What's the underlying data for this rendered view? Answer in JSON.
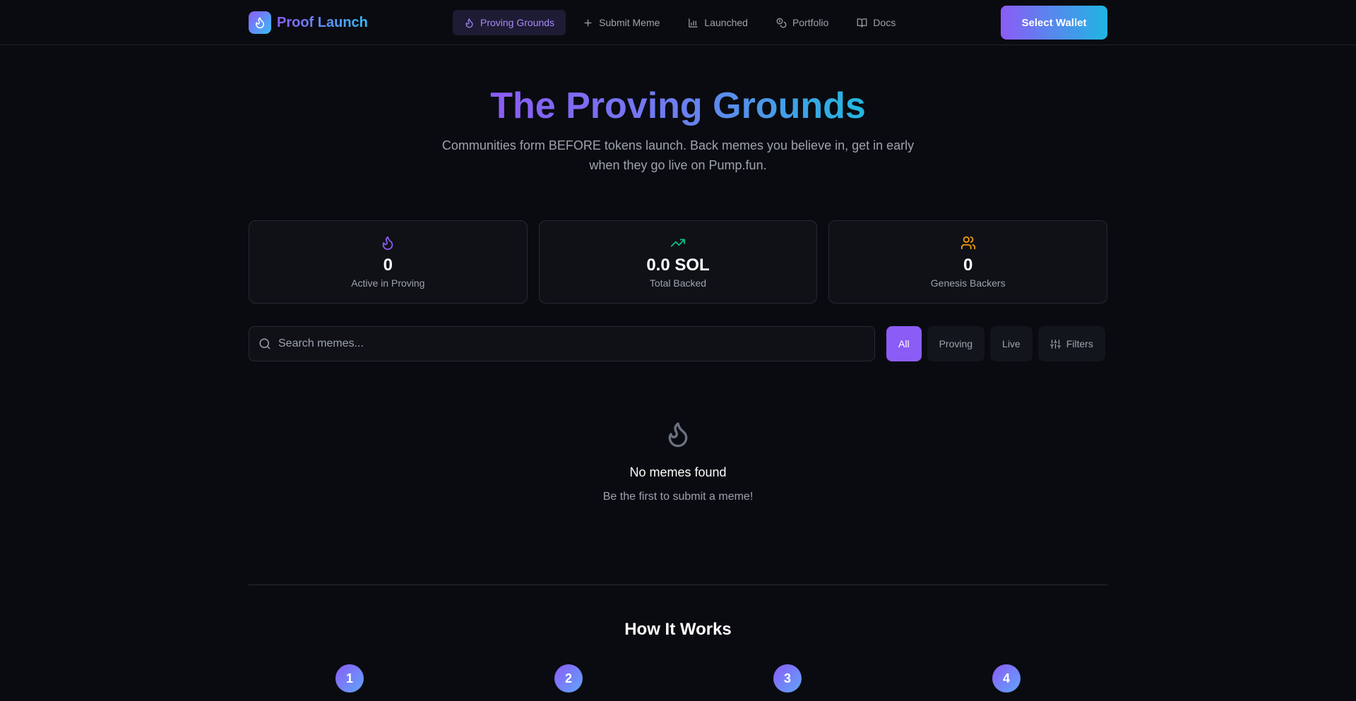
{
  "brand": {
    "name": "Proof Launch",
    "logo_icon": "flame-icon"
  },
  "nav": {
    "items": [
      {
        "label": "Proving Grounds",
        "icon": "flame-icon",
        "active": true
      },
      {
        "label": "Submit Meme",
        "icon": "plus-icon",
        "active": false
      },
      {
        "label": "Launched",
        "icon": "bar-chart-icon",
        "active": false
      },
      {
        "label": "Portfolio",
        "icon": "coins-icon",
        "active": false
      },
      {
        "label": "Docs",
        "icon": "book-icon",
        "active": false
      }
    ],
    "wallet_label": "Select Wallet"
  },
  "hero": {
    "title": "The Proving Grounds",
    "subtitle": "Communities form BEFORE tokens launch. Back memes you believe in, get in early when they go live on Pump.fun."
  },
  "stats": [
    {
      "value": "0",
      "label": "Active in Proving",
      "icon": "flame-icon",
      "color": "#8b5cf6"
    },
    {
      "value": "0.0 SOL",
      "label": "Total Backed",
      "icon": "trending-up-icon",
      "color": "#10b981"
    },
    {
      "value": "0",
      "label": "Genesis Backers",
      "icon": "users-icon",
      "color": "#f59e0b"
    }
  ],
  "search": {
    "placeholder": "Search memes..."
  },
  "filters": {
    "all": "All",
    "proving": "Proving",
    "live": "Live",
    "more": "Filters"
  },
  "empty": {
    "title": "No memes found",
    "subtitle": "Be the first to submit a meme!"
  },
  "how": {
    "title": "How It Works",
    "steps": [
      "1",
      "2",
      "3",
      "4"
    ]
  },
  "colors": {
    "accent": "#8b5cf6",
    "accent2": "#22b8e0",
    "background": "#0a0b10"
  }
}
